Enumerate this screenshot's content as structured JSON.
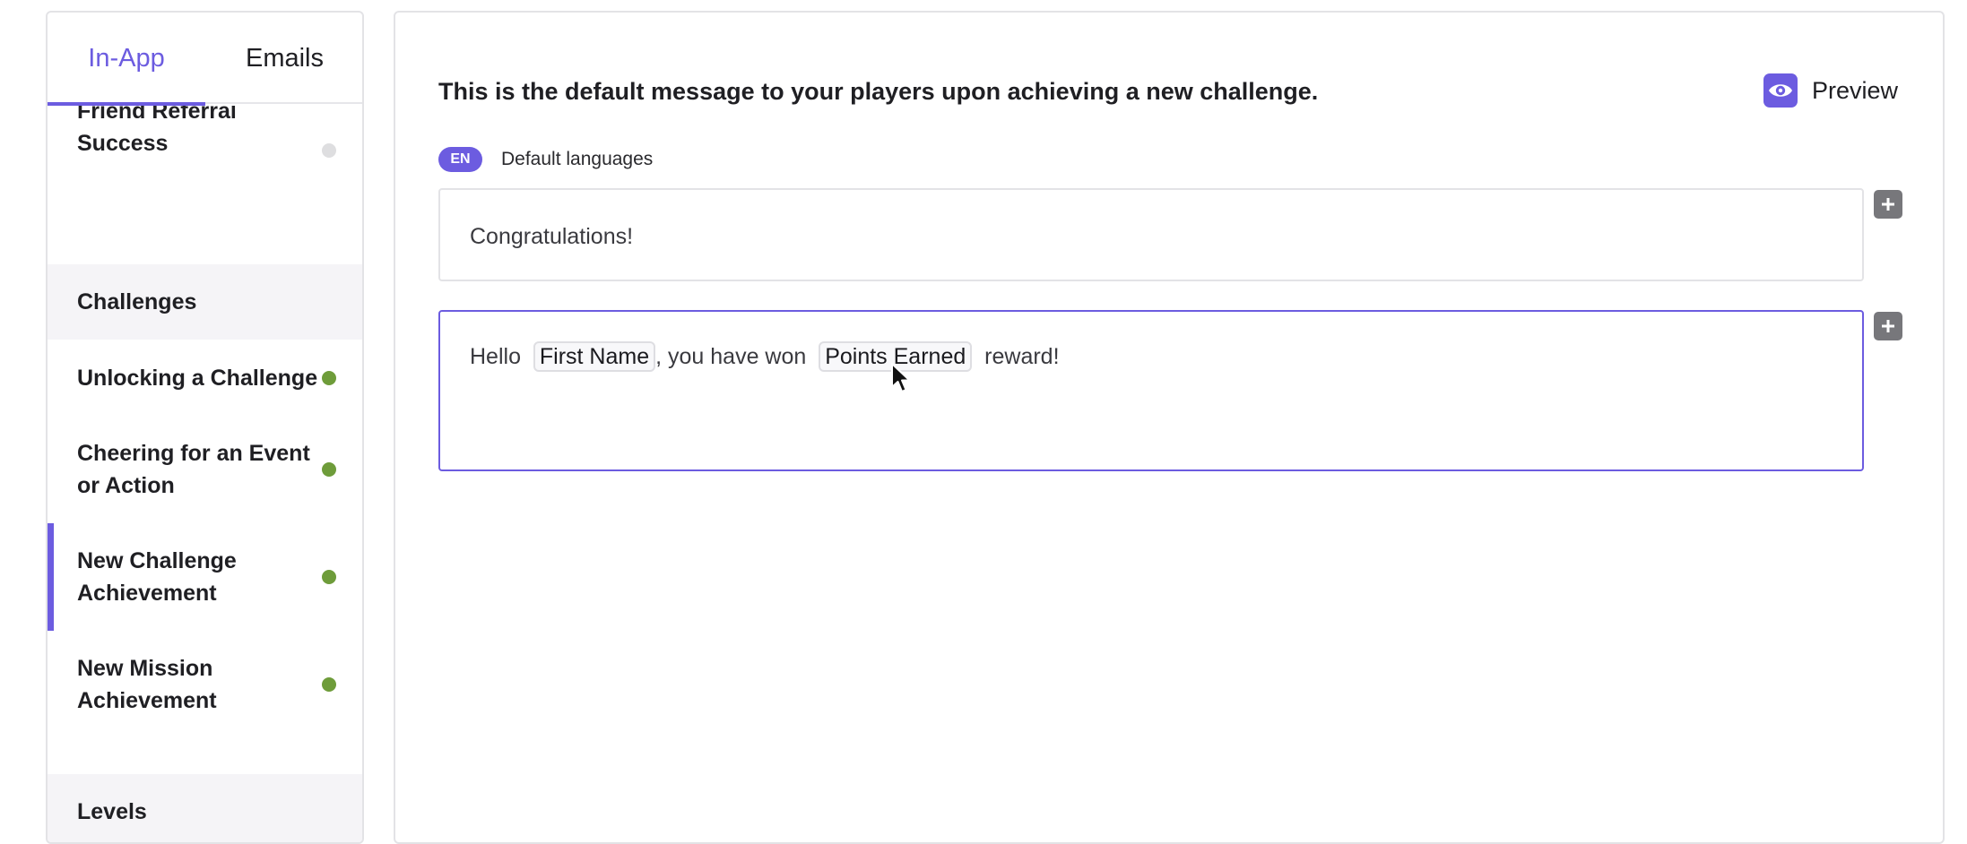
{
  "tabs": {
    "inapp_label": "In-App",
    "emails_label": "Emails"
  },
  "sidebar": {
    "items": [
      {
        "label": "Friend Referral Success",
        "status": "inactive"
      },
      {
        "label": "Unlocking a Challenge",
        "status": "active"
      },
      {
        "label": "Cheering for an Event or Action",
        "status": "active"
      },
      {
        "label": "New Challenge Achievement",
        "status": "active",
        "selected": true
      },
      {
        "label": "New Mission Achievement",
        "status": "active"
      }
    ],
    "sections": [
      {
        "label": "Challenges"
      },
      {
        "label": "Levels"
      }
    ]
  },
  "main": {
    "description": "This is the default message to your players upon achieving a new challenge.",
    "preview_label": "Preview",
    "language": {
      "badge": "EN",
      "label": "Default languages"
    },
    "title_field": {
      "value": "Congratulations!"
    },
    "body_field": {
      "prefix": "Hello",
      "token1": "First Name",
      "middle": ", you have won",
      "token2": "Points Earned",
      "suffix": "reward!"
    }
  },
  "icons": {
    "preview": "eye-icon",
    "add": "plus-icon",
    "cursor": "mouse-pointer-icon"
  },
  "colors": {
    "accent": "#6c5ce0",
    "status_active": "#6e9c3a",
    "status_inactive": "#dedee0",
    "add_button": "#77777b"
  }
}
